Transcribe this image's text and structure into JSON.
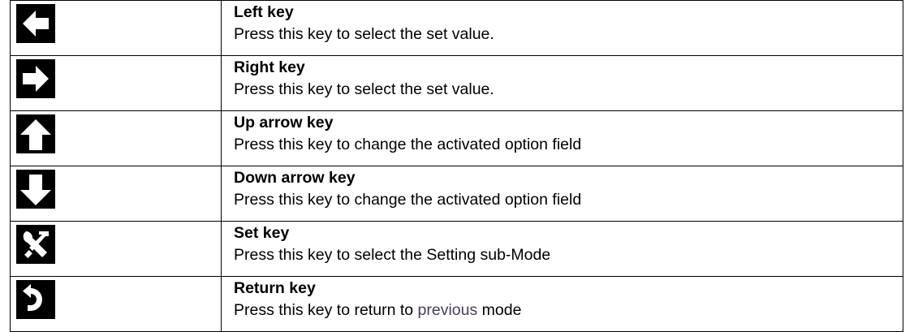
{
  "keys": [
    {
      "icon": "left-arrow-icon",
      "title": "Left key",
      "description": "Press this key to select the set value."
    },
    {
      "icon": "right-arrow-icon",
      "title": "Right key",
      "description": "Press this key to select the set value."
    },
    {
      "icon": "up-arrow-icon",
      "title": "Up arrow key",
      "description": "Press this key to change the activated option field"
    },
    {
      "icon": "down-arrow-icon",
      "title": "Down arrow key",
      "description": "Press this key to change the activated option field"
    },
    {
      "icon": "tools-icon",
      "title": "Set key",
      "description": "Press this key to select the Setting sub-Mode"
    },
    {
      "icon": "return-icon",
      "title": "Return key",
      "description_parts": [
        "Press this key to return to ",
        "previous",
        " mode"
      ]
    }
  ],
  "colors": {
    "icon_background": "#000000",
    "icon_foreground": "#ffffff",
    "border": "#000000",
    "highlight_text": "#4a3c5a"
  }
}
